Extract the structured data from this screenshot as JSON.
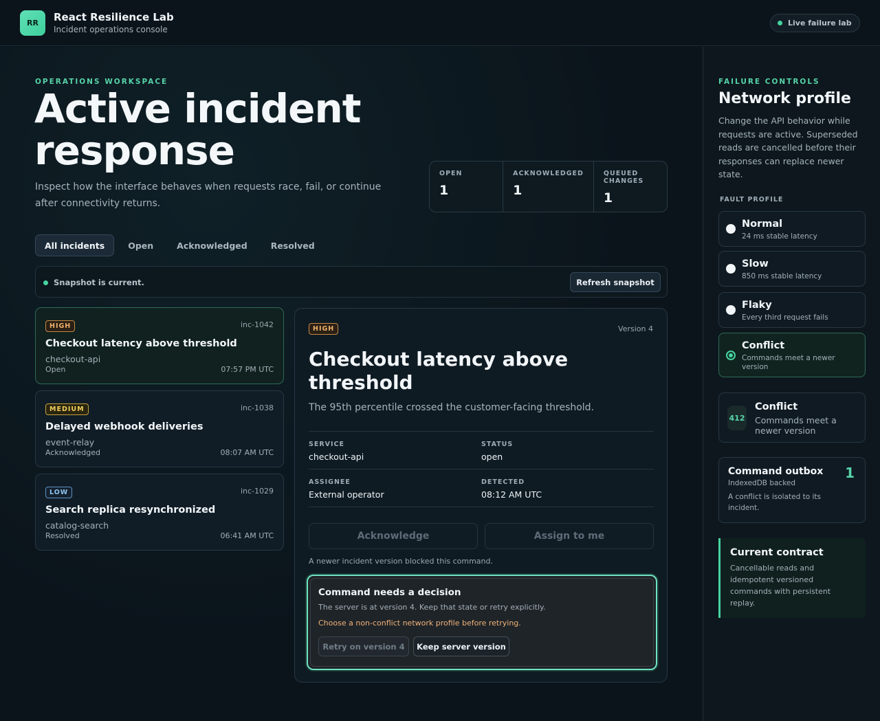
{
  "header": {
    "logo": "RR",
    "title": "React Resilience Lab",
    "subtitle": "Incident operations console",
    "live_label": "Live failure lab"
  },
  "workspace": {
    "eyebrow": "OPERATIONS WORKSPACE",
    "title": "Active incident response",
    "description": "Inspect how the interface behaves when requests race, fail, or continue after connectivity returns."
  },
  "stats": [
    {
      "label": "OPEN",
      "value": "1"
    },
    {
      "label": "ACKNOWLEDGED",
      "value": "1"
    },
    {
      "label": "QUEUED CHANGES",
      "value": "1"
    }
  ],
  "tabs": [
    {
      "label": "All incidents",
      "active": true
    },
    {
      "label": "Open"
    },
    {
      "label": "Acknowledged"
    },
    {
      "label": "Resolved"
    }
  ],
  "snapshot": {
    "status": "Snapshot is current.",
    "refresh_label": "Refresh snapshot"
  },
  "incidents": [
    {
      "severity": "HIGH",
      "id": "inc-1042",
      "title": "Checkout latency above threshold",
      "service": "checkout-api",
      "status": "Open",
      "time": "07:57 PM UTC"
    },
    {
      "severity": "MEDIUM",
      "id": "inc-1038",
      "title": "Delayed webhook deliveries",
      "service": "event-relay",
      "status": "Acknowledged",
      "time": "08:07 AM UTC"
    },
    {
      "severity": "LOW",
      "id": "inc-1029",
      "title": "Search replica resynchronized",
      "service": "catalog-search",
      "status": "Resolved",
      "time": "06:41 AM UTC"
    }
  ],
  "detail": {
    "severity": "HIGH",
    "version": "Version 4",
    "title": "Checkout latency above threshold",
    "description": "The 95th percentile crossed the customer-facing threshold.",
    "fields": {
      "service_label": "SERVICE",
      "service": "checkout-api",
      "status_label": "STATUS",
      "status": "open",
      "assignee_label": "ASSIGNEE",
      "assignee": "External operator",
      "detected_label": "DETECTED",
      "detected": "08:12 AM UTC"
    },
    "acknowledge_label": "Acknowledge",
    "assign_label": "Assign to me",
    "note": "A newer incident version blocked this command.",
    "decision": {
      "title": "Command needs a decision",
      "text": "The server is at version 4. Keep that state or retry explicitly.",
      "warning": "Choose a non-conflict network profile before retrying.",
      "retry_label": "Retry on version 4",
      "keep_label": "Keep server version"
    }
  },
  "sidebar": {
    "eyebrow": "FAILURE CONTROLS",
    "title": "Network profile",
    "description": "Change the API behavior while requests are active. Superseded reads are cancelled before their responses can replace newer state.",
    "profile_label": "FAULT PROFILE",
    "profiles": [
      {
        "name": "Normal",
        "desc": "24 ms stable latency",
        "selected": false
      },
      {
        "name": "Slow",
        "desc": "850 ms stable latency",
        "selected": false
      },
      {
        "name": "Flaky",
        "desc": "Every third request fails",
        "selected": false
      },
      {
        "name": "Conflict",
        "desc": "Commands meet a newer version",
        "selected": true
      }
    ],
    "status_card": {
      "code": "412",
      "name": "Conflict",
      "desc": "Commands meet a newer version"
    },
    "outbox": {
      "title": "Command outbox",
      "count": "1",
      "sub": "IndexedDB backed",
      "desc": "A conflict is isolated to its incident."
    },
    "contract": {
      "title": "Current contract",
      "desc": "Cancellable reads and idempotent versioned commands with persistent replay."
    }
  },
  "colors": {
    "accent": "#46d49f",
    "high": "#f0b16c",
    "medium": "#f0cd5c",
    "low": "#8dc3f0"
  }
}
